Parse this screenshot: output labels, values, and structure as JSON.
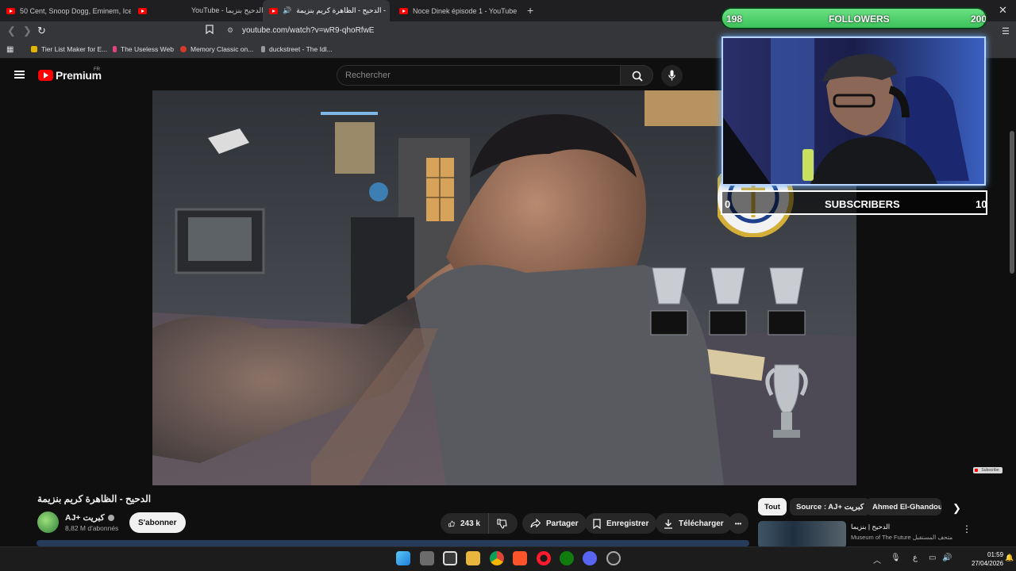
{
  "browser": {
    "tabs": [
      {
        "label": "50 Cent, Snoop Dogg, Eminem, Ice C"
      },
      {
        "label": "YouTube - الدحيح بنزيما"
      },
      {
        "label": "الدحيح - الظاهرة كريم بنزيمة -"
      },
      {
        "label": "Noce Dinek épisode 1 - YouTube"
      }
    ],
    "new_tab": "+",
    "close_glyph": "✕",
    "url": "youtube.com/watch?v=wR9-qhoRfwE",
    "bookmarks": [
      {
        "label": "Tier List Maker for E...",
        "color": "#e0b400"
      },
      {
        "label": "The Useless Web",
        "color": "#e0447a"
      },
      {
        "label": "Memory Classic on...",
        "color": "#d83a2a"
      },
      {
        "label": "duckstreet - The Idl...",
        "color": "#9a9a9a"
      }
    ]
  },
  "youtube": {
    "logo": "Premium",
    "logo_region": "FR",
    "search_placeholder": "Rechercher",
    "video_title": "الدحيح - الظاهرة كريم بنزيمة",
    "channel_name": "AJ+ كبريت",
    "channel_subs": "8,82 M d'abonnés",
    "subscribe": "S'abonner",
    "likes": "243 k",
    "share": "Partager",
    "save": "Enregistrer",
    "download": "Télécharger",
    "more": "•••",
    "subscribe_watermark": "Subscribe",
    "chips": [
      "Tout",
      "Source : AJ+ كبريت",
      "Ahmed El-Ghandour"
    ],
    "rec": {
      "title": "الدحيح | بنزيما",
      "channel": "Museum of The Future متحف المستقبل"
    }
  },
  "overlay": {
    "followers_label": "FOLLOWERS",
    "followers_current": "198",
    "followers_goal": "200",
    "followers_progress": 0.99,
    "subscribers_label": "SUBSCRIBERS",
    "subscribers_current": "0",
    "subscribers_goal": "10"
  },
  "taskbar": {
    "time": "01:59",
    "date": "27/04/2026",
    "lang": "ع"
  },
  "colors": {
    "yt_red": "#ff0000",
    "goal_green": "#3cc15a",
    "cam_border": "#b8d4ff"
  }
}
